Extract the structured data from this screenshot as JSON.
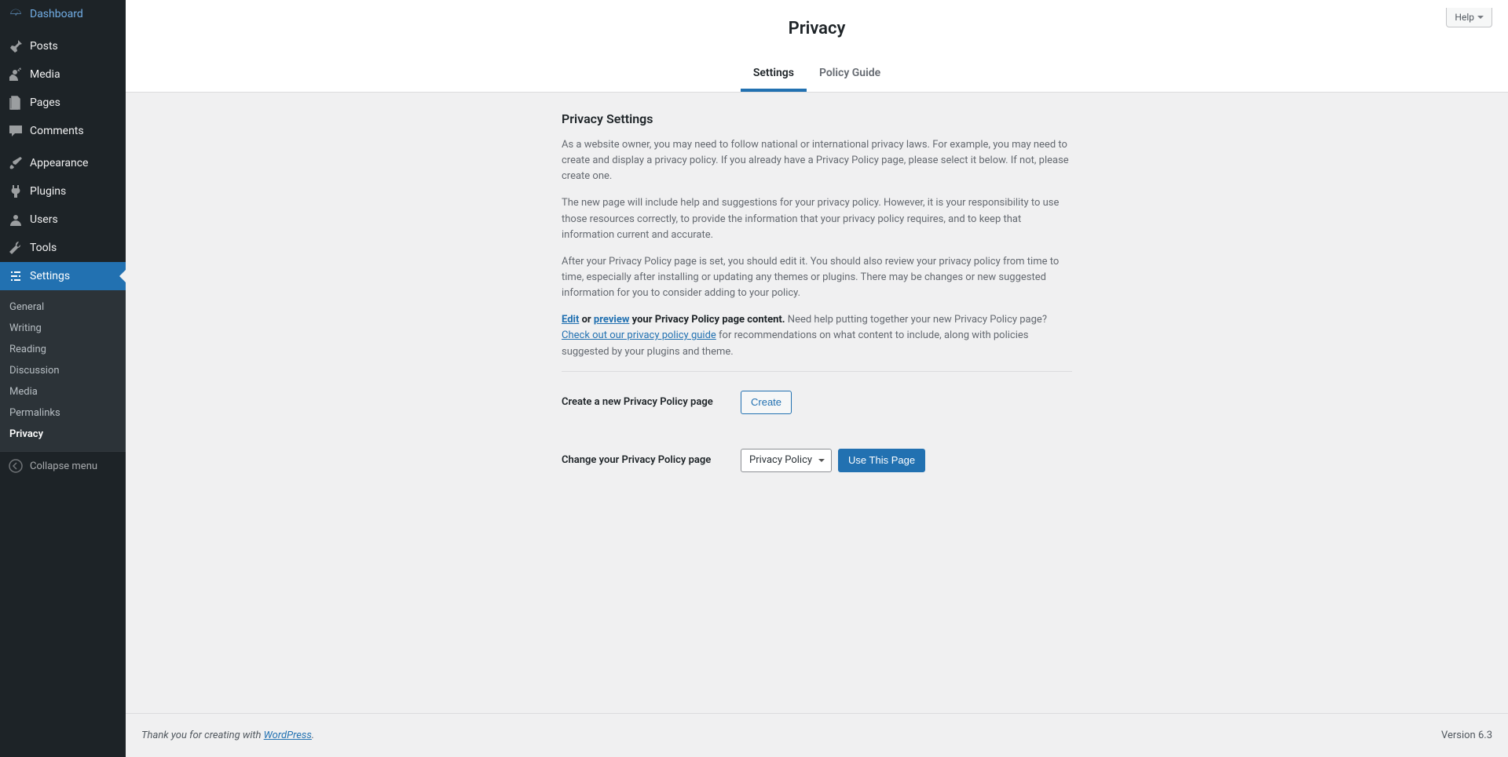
{
  "help_label": "Help",
  "sidebar": {
    "items": [
      {
        "label": "Dashboard"
      },
      {
        "label": "Posts"
      },
      {
        "label": "Media"
      },
      {
        "label": "Pages"
      },
      {
        "label": "Comments"
      },
      {
        "label": "Appearance"
      },
      {
        "label": "Plugins"
      },
      {
        "label": "Users"
      },
      {
        "label": "Tools"
      },
      {
        "label": "Settings"
      }
    ],
    "submenu": [
      {
        "label": "General"
      },
      {
        "label": "Writing"
      },
      {
        "label": "Reading"
      },
      {
        "label": "Discussion"
      },
      {
        "label": "Media"
      },
      {
        "label": "Permalinks"
      },
      {
        "label": "Privacy"
      }
    ],
    "collapse_label": "Collapse menu"
  },
  "page_title": "Privacy",
  "tabs": {
    "settings": "Settings",
    "policy": "Policy Guide"
  },
  "section_title": "Privacy Settings",
  "para1": "As a website owner, you may need to follow national or international privacy laws. For example, you may need to create and display a privacy policy. If you already have a Privacy Policy page, please select it below. If not, please create one.",
  "para2": "The new page will include help and suggestions for your privacy policy. However, it is your responsibility to use those resources correctly, to provide the information that your privacy policy requires, and to keep that information current and accurate.",
  "para3": "After your Privacy Policy page is set, you should edit it. You should also review your privacy policy from time to time, especially after installing or updating any themes or plugins. There may be changes or new suggested information for you to consider adding to your policy.",
  "edit_link": "Edit",
  "or_text": " or ",
  "preview_link": "preview",
  "pp_bold": " your Privacy Policy page content.",
  "need_help": " Need help putting together your new Privacy Policy page? ",
  "guide_link": "Check out our privacy policy guide",
  "reco_text": " for recommendations on what content to include, along with policies suggested by your plugins and theme.",
  "create_label": "Create a new Privacy Policy page",
  "create_button": "Create",
  "change_label": "Change your Privacy Policy page",
  "select_value": "Privacy Policy",
  "use_button": "Use This Page",
  "footer": {
    "prefix": "Thank you for creating with ",
    "link": "WordPress",
    "suffix": ".",
    "version": "Version 6.3"
  }
}
